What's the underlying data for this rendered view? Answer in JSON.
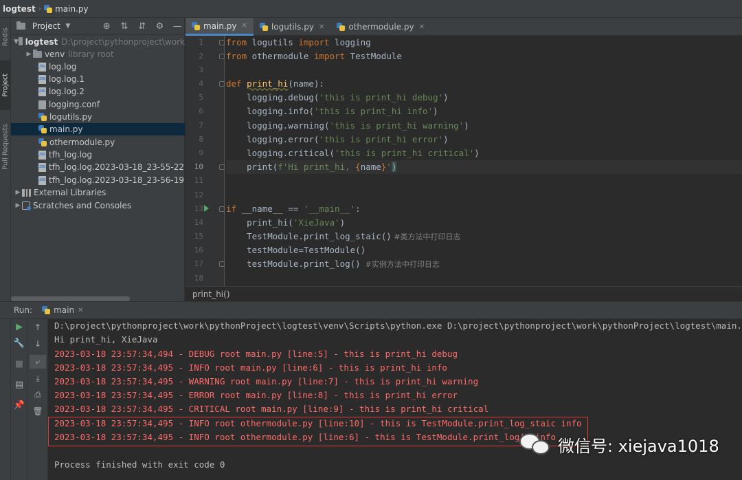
{
  "navbar": {
    "project": "logtest",
    "file": "main.py"
  },
  "left_strip": {
    "tabs": [
      "Redis",
      "Project",
      "Pull Requests"
    ]
  },
  "project_panel": {
    "title": "Project",
    "tree": [
      {
        "label": "logtest",
        "hint": "D:\\project\\pythonproject\\work",
        "kind": "root"
      },
      {
        "label": "venv",
        "hint": "library root",
        "kind": "folder"
      },
      {
        "label": "log.log",
        "kind": "log"
      },
      {
        "label": "log.log.1",
        "kind": "log"
      },
      {
        "label": "log.log.2",
        "kind": "log"
      },
      {
        "label": "logging.conf",
        "kind": "conf"
      },
      {
        "label": "logutils.py",
        "kind": "py"
      },
      {
        "label": "main.py",
        "kind": "py"
      },
      {
        "label": "othermodule.py",
        "kind": "py"
      },
      {
        "label": "tfh_log.log",
        "kind": "log"
      },
      {
        "label": "tfh_log.log.2023-03-18_23-55-22",
        "kind": "log"
      },
      {
        "label": "tfh_log.log.2023-03-18_23-56-19",
        "kind": "log"
      },
      {
        "label": "External Libraries",
        "kind": "lib"
      },
      {
        "label": "Scratches and Consoles",
        "kind": "scratch"
      }
    ]
  },
  "tabs": [
    {
      "label": "main.py",
      "active": true
    },
    {
      "label": "logutils.py",
      "active": false
    },
    {
      "label": "othermodule.py",
      "active": false
    }
  ],
  "editor": {
    "line_numbers": [
      "1",
      "2",
      "3",
      "4",
      "5",
      "6",
      "7",
      "8",
      "9",
      "10",
      "11",
      "12",
      "13",
      "14",
      "15",
      "16",
      "17",
      "18"
    ],
    "current_line": "10",
    "lines": [
      {
        "kw1": "from",
        "t1": " logutils ",
        "kw2": "import",
        "t2": " logging"
      },
      {
        "kw1": "from",
        "t1": " othermodule ",
        "kw2": "import",
        "t2": " TestModule"
      },
      {},
      {
        "kw1": "def",
        "fn": "print_hi",
        "t1": "(name):"
      },
      {
        "pre": "    logging.debug(",
        "str": "'this is print_hi debug'",
        "post": ")"
      },
      {
        "pre": "    logging.info(",
        "str": "'this is print_hi info'",
        "post": ")"
      },
      {
        "pre": "    logging.warning(",
        "str": "'this is print_hi warning'",
        "post": ")"
      },
      {
        "pre": "    logging.error(",
        "str": "'this is print_hi error'",
        "post": ")"
      },
      {
        "pre": "    logging.critical(",
        "str": "'this is print_hi critical'",
        "post": ")"
      },
      {
        "pre": "    print(",
        "fstr1": "f'Hi print_hi, ",
        "brace1": "{",
        "var": "name",
        "brace2": "}",
        "fstr2": "'",
        "post": ")"
      },
      {},
      {},
      {
        "kw1": "if",
        "t1": " __name__ == ",
        "str": "'__main__'",
        "t2": ":"
      },
      {
        "pre": "    print_hi(",
        "str": "'XieJava'",
        "post": ")"
      },
      {
        "pre": "    TestModule.print_log_staic()",
        "cm": " #类方法中打印日志"
      },
      {
        "pre": "    testModule=TestModule()"
      },
      {
        "pre": "    testModule.print_log()",
        "cm": "  #实例方法中打印日志"
      },
      {}
    ]
  },
  "breadcrumb": "print_hi()",
  "run_panel": {
    "label": "Run:",
    "config": "main",
    "console": [
      {
        "text": "D:\\project\\pythonproject\\work\\pythonProject\\logtest\\venv\\Scripts\\python.exe D:\\project\\pythonproject\\work\\pythonProject\\logtest\\main.py",
        "type": "normal"
      },
      {
        "text": "Hi print_hi, XieJava",
        "type": "normal"
      },
      {
        "text": "2023-03-18 23:57:34,494 - DEBUG root main.py [line:5] - this is print_hi debug",
        "type": "error"
      },
      {
        "text": "2023-03-18 23:57:34,495 - INFO root main.py [line:6] - this is print_hi info",
        "type": "error"
      },
      {
        "text": "2023-03-18 23:57:34,495 - WARNING root main.py [line:7] - this is print_hi warning",
        "type": "error"
      },
      {
        "text": "2023-03-18 23:57:34,495 - ERROR root main.py [line:8] - this is print_hi error",
        "type": "error"
      },
      {
        "text": "2023-03-18 23:57:34,495 - CRITICAL root main.py [line:9] - this is print_hi critical",
        "type": "error"
      },
      {
        "text": "2023-03-18 23:57:34,495 - INFO root othermodule.py [line:10] - this is TestModule.print_log_staic info",
        "type": "error"
      },
      {
        "text": "2023-03-18 23:57:34,495 - INFO root othermodule.py [line:6] - this is TestModule.print_log() info",
        "type": "error"
      },
      {
        "text": "",
        "type": "normal"
      },
      {
        "text": "Process finished with exit code 0",
        "type": "normal"
      }
    ]
  },
  "watermark": {
    "text": "微信号: xiejava1018"
  },
  "colors": {
    "keyword": "#cc7832",
    "string": "#6a8759",
    "function": "#ffc66d",
    "error_output": "#ff6b68",
    "highlight_box": "#e03c3c"
  }
}
